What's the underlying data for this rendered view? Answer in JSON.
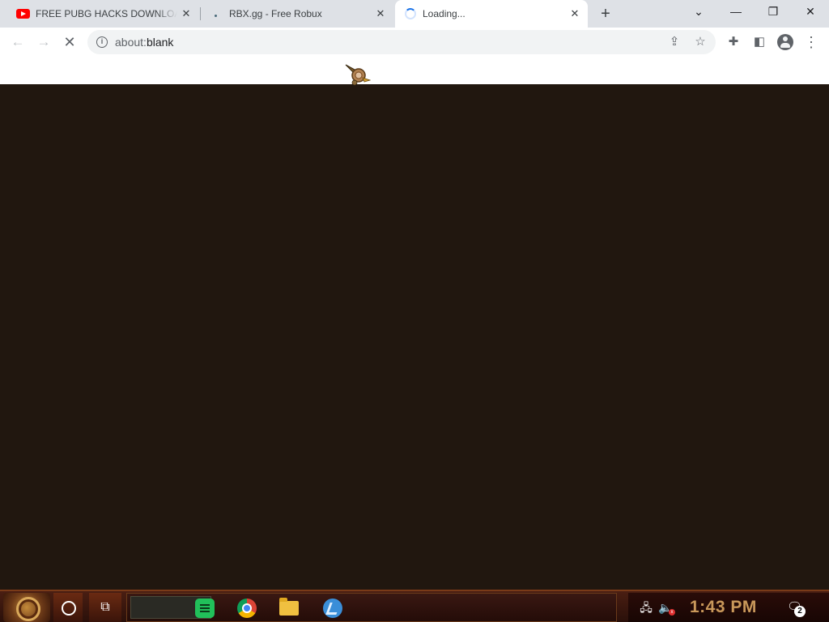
{
  "browser": {
    "tabs": [
      {
        "title": "FREE PUBG HACKS DOWNLOAD",
        "favicon": "youtube-icon",
        "active": false
      },
      {
        "title": "RBX.gg - Free Robux",
        "favicon": "site-icon",
        "active": false
      },
      {
        "title": "Loading...",
        "favicon": "loading-spinner-icon",
        "active": true
      }
    ],
    "tab_close_glyph": "✕",
    "new_tab_glyph": "+",
    "window_controls": {
      "tab_search": "⌄",
      "minimize": "—",
      "maximize": "❐",
      "close": "✕"
    },
    "toolbar": {
      "back_glyph": "←",
      "forward_glyph": "→",
      "stop_glyph": "✕",
      "info_glyph": "i",
      "url_scheme": "about:",
      "url_host": "blank",
      "share_glyph": "⇪",
      "bookmark_glyph": "☆",
      "extensions_glyph": "✚",
      "sidepanel_glyph": "◧",
      "menu_glyph": "⋮"
    }
  },
  "page": {
    "background_color": "#21170f",
    "cursor": "steampunk-pointer-icon"
  },
  "taskbar": {
    "pinned_apps": [
      "sticky-notes-icon",
      "chrome-icon",
      "file-explorer-icon",
      "blue-app-icon"
    ],
    "task_view_glyph": "⧉",
    "tray": {
      "network_glyph": "🖧",
      "volume_glyph": "🔈",
      "volume_muted_glyph": "x",
      "clock": "1:43 PM",
      "notification_glyph": "🗨",
      "notification_count": "2"
    },
    "accent_color": "#c9985a"
  }
}
